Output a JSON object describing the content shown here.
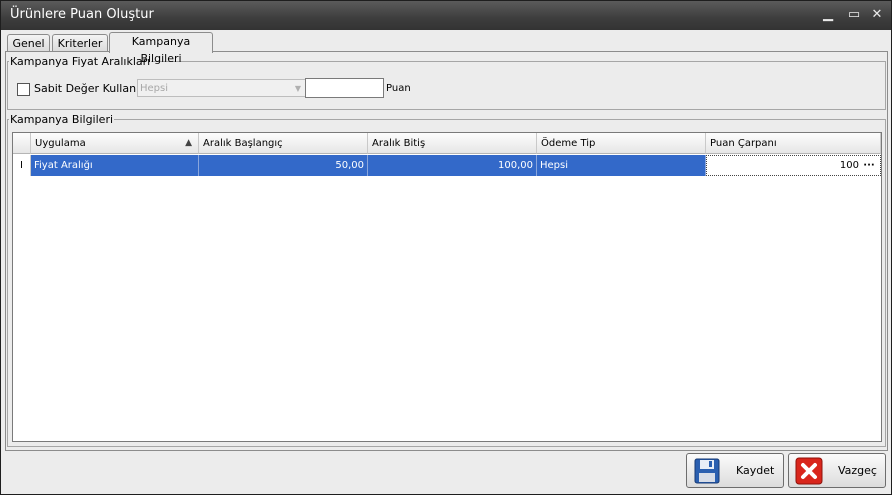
{
  "window": {
    "title": "Ürünlere Puan Oluştur",
    "minimize_glyph": "▁",
    "maximize_glyph": "▭",
    "close_glyph": "✕"
  },
  "tabs": [
    {
      "label": "Genel",
      "active": false
    },
    {
      "label": "Kriterler",
      "active": false
    },
    {
      "label": "Kampanya Bilgileri",
      "active": true
    }
  ],
  "price_ranges": {
    "legend": "Kampanya Fiyat Aralıkları",
    "fixed_value_label": "Sabit Değer Kullan",
    "fixed_value_checked": false,
    "combo_value": "Hepsi",
    "points_value": "",
    "points_label": "Puan"
  },
  "campaign_info": {
    "legend": "Kampanya Bilgileri",
    "columns": [
      "Uygulama",
      "Aralık Başlangıç",
      "Aralık Bitiş",
      "Ödeme Tip",
      "Puan Çarpanı"
    ],
    "sort_indicator": "▲",
    "row_indicator": "I",
    "rows": [
      {
        "uygulama": "Fiyat Aralığı",
        "baslangic": "50,00",
        "bitis": "100,00",
        "odeme_tip": "Hepsi",
        "puan_carpani": "100"
      }
    ],
    "ellipsis": "···"
  },
  "footer": {
    "save_label": "Kaydet",
    "cancel_label": "Vazgeç"
  },
  "colors": {
    "selection": "#3369c9",
    "titlebar": "#3d3d3d",
    "cancel_icon": "#d9261c"
  }
}
